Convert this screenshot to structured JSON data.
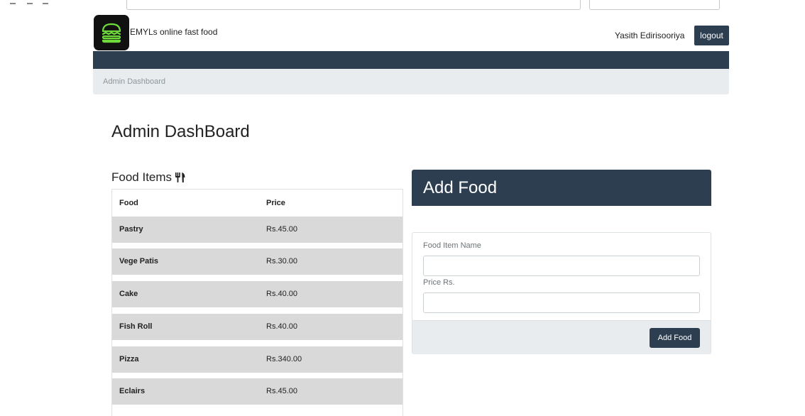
{
  "header": {
    "brand": "EMYLs online fast food",
    "username": "Yasith Edirisooriya",
    "logout_label": "logout"
  },
  "breadcrumb": "Admin Dashboard",
  "page_title": "Admin DashBoard",
  "food_items": {
    "heading": "Food Items",
    "icon": "utensils-icon",
    "columns": [
      "Food",
      "Price"
    ],
    "rows": [
      {
        "food": "Pastry",
        "price": "Rs.45.00"
      },
      {
        "food": "Vege Patis",
        "price": "Rs.30.00"
      },
      {
        "food": "Cake",
        "price": "Rs.40.00"
      },
      {
        "food": "Fish Roll",
        "price": "Rs.40.00"
      },
      {
        "food": "Pizza",
        "price": "Rs.340.00"
      },
      {
        "food": "Eclairs",
        "price": "Rs.45.00"
      }
    ]
  },
  "add_food": {
    "title": "Add Food",
    "name_label": "Food Item Name",
    "name_value": "",
    "price_label": "Price Rs.",
    "price_value": "",
    "submit_label": "Add Food"
  },
  "colors": {
    "navy": "#2d3e50",
    "logo_green": "#6fdb3a",
    "row_gray": "#d9d9d9"
  }
}
